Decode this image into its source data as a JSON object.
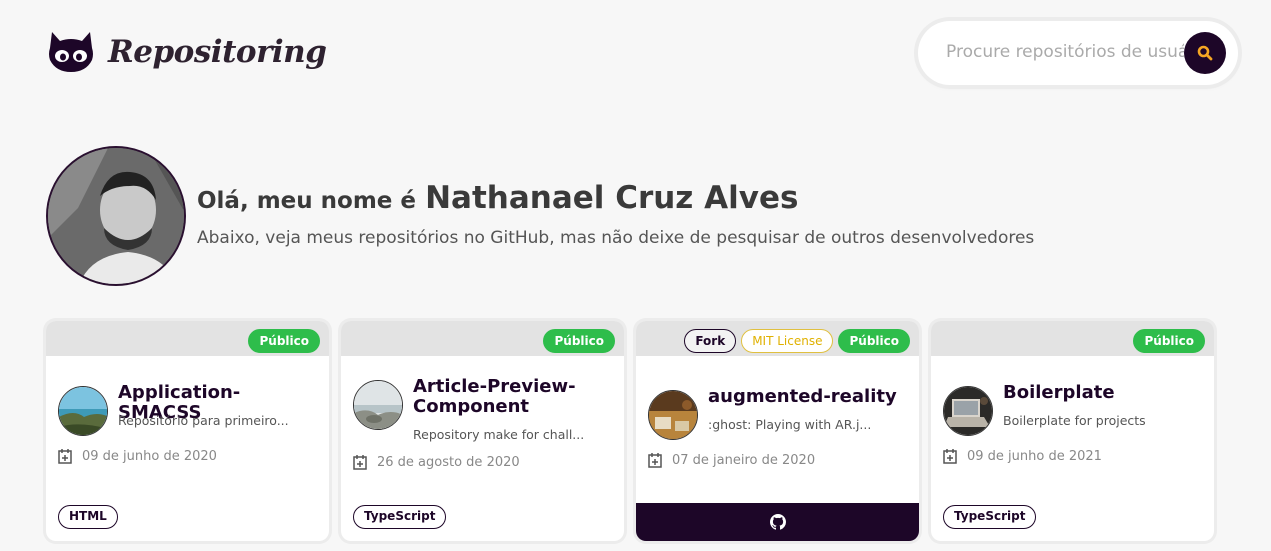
{
  "header": {
    "logo_text": "Repositoring",
    "search_placeholder": "Procure repositórios de usuários"
  },
  "profile": {
    "greeting_prefix": "Olá, meu nome é",
    "name": "Nathanael Cruz Alves",
    "subtitle": "Abaixo, veja meus repositórios no GitHub, mas não deixe de pesquisar de outros desenvolvedores"
  },
  "colors": {
    "brand_dark": "#1d0628",
    "public_green": "#2ebd4b",
    "license_yellow": "#e0b100"
  },
  "repos": [
    {
      "tags": [
        "Público"
      ],
      "title": "Application-SMACSS",
      "description": "Repositório para primeiro...",
      "date": "09 de junho de 2020",
      "language": "HTML"
    },
    {
      "tags": [
        "Público"
      ],
      "title": "Article-Preview-Component",
      "description": "Repository make for chall...",
      "date": "26 de agosto de 2020",
      "language": "TypeScript"
    },
    {
      "tags": [
        "Fork",
        "MIT License",
        "Público"
      ],
      "title": "augmented-reality",
      "description": ":ghost: Playing with AR.j...",
      "date": "07 de janeiro de 2020",
      "icon": "github-icon"
    },
    {
      "tags": [
        "Público"
      ],
      "title": "Boilerplate",
      "description": "Boilerplate for projects",
      "date": "09 de junho de 2021",
      "language": "TypeScript"
    }
  ]
}
